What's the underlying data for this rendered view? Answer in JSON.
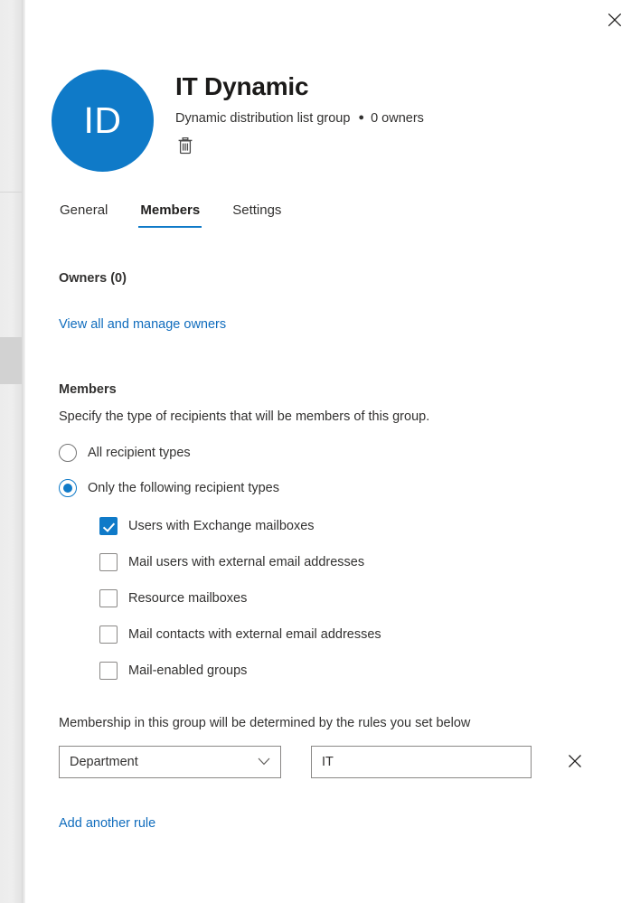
{
  "panel": {
    "close_label": "Close",
    "close_icon": "close-icon"
  },
  "header": {
    "avatar_initials": "ID",
    "title": "IT Dynamic",
    "group_type": "Dynamic distribution list group",
    "separator": "●",
    "owners_summary": "0 owners",
    "delete_icon": "trash-icon"
  },
  "tabs": [
    {
      "label": "General",
      "active": false
    },
    {
      "label": "Members",
      "active": true
    },
    {
      "label": "Settings",
      "active": false
    }
  ],
  "owners": {
    "heading": "Owners (0)",
    "manage_link": "View all and manage owners"
  },
  "members": {
    "heading": "Members",
    "description": "Specify the type of recipients that will be members of this group.",
    "recipient_scope": [
      {
        "label": "All recipient types",
        "checked": false
      },
      {
        "label": "Only the following recipient types",
        "checked": true
      }
    ],
    "recipient_types": [
      {
        "label": "Users with Exchange mailboxes",
        "checked": true
      },
      {
        "label": "Mail users with external email addresses",
        "checked": false
      },
      {
        "label": "Resource mailboxes",
        "checked": false
      },
      {
        "label": "Mail contacts with external email addresses",
        "checked": false
      },
      {
        "label": "Mail-enabled groups",
        "checked": false
      }
    ]
  },
  "rules": {
    "description": "Membership in this group will be determined by the rules you set below",
    "attribute_value": "Department",
    "attribute_chevron_icon": "chevron-down-icon",
    "value_text": "IT",
    "value_placeholder": "",
    "remove_icon": "close-icon",
    "add_link": "Add another rule"
  },
  "colors": {
    "accent": "#0f7ac8",
    "link": "#0f6cbd",
    "text": "#323130"
  }
}
